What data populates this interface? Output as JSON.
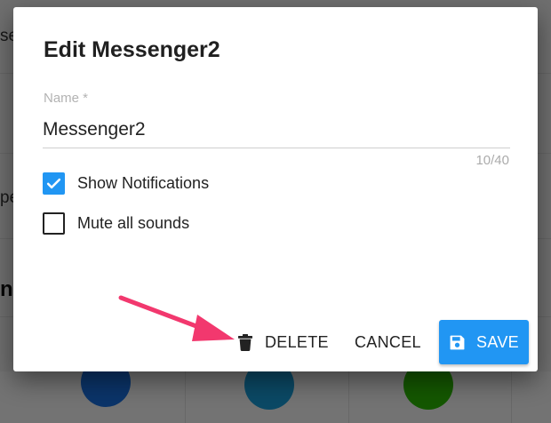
{
  "background": {
    "rows": [
      "se",
      "pe"
    ],
    "heading": "ne"
  },
  "dialog": {
    "title": "Edit Messenger2",
    "name_field": {
      "label": "Name *",
      "value": "Messenger2",
      "counter": "10/40"
    },
    "checkboxes": [
      {
        "label": "Show Notifications",
        "checked": true
      },
      {
        "label": "Mute all sounds",
        "checked": false
      }
    ],
    "actions": {
      "delete_label": "DELETE",
      "cancel_label": "CANCEL",
      "save_label": "SAVE"
    }
  },
  "icons": {
    "delete": "trash-icon",
    "save": "floppy-disk-icon",
    "checkbox_checked": "check-icon",
    "annotation": "arrow-pointer"
  },
  "colors": {
    "accent": "#2196f3",
    "annotation_arrow": "#f2386e",
    "messenger": "#1a73e8",
    "skype": "#1aa3e0",
    "wechat": "#2dc100"
  }
}
